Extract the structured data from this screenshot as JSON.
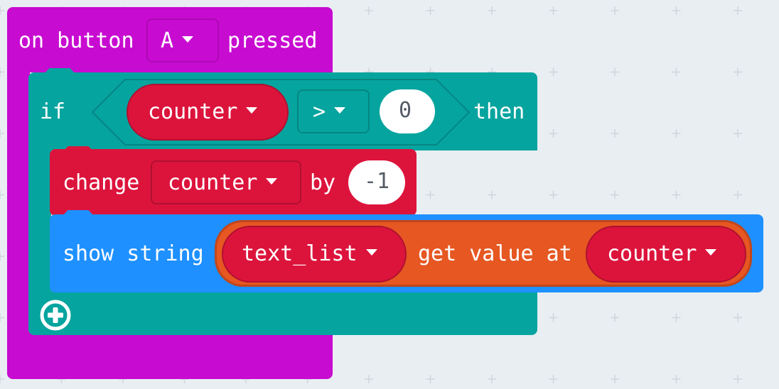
{
  "event_block": {
    "prefix": "on button",
    "button_value": "A",
    "suffix": "pressed"
  },
  "if_block": {
    "if_label": "if",
    "then_label": "then",
    "compare": {
      "left_variable": "counter",
      "operator": ">",
      "right_value": "0"
    }
  },
  "change_block": {
    "prefix": "change",
    "variable": "counter",
    "by_label": "by",
    "amount": "-1"
  },
  "show_block": {
    "prefix": "show string",
    "list_variable": "text_list",
    "get_label": "get value at",
    "index_variable": "counter"
  },
  "colors": {
    "event_block": "#c80bd1",
    "logic_block": "#06a49f",
    "variable_block": "#dc143c",
    "basic_block": "#1e90ff",
    "array_block": "#e65722",
    "workspace": "#e9eef2"
  },
  "icons": {
    "add_else": "plus-circle-icon",
    "dropdown": "triangle-down-icon"
  }
}
